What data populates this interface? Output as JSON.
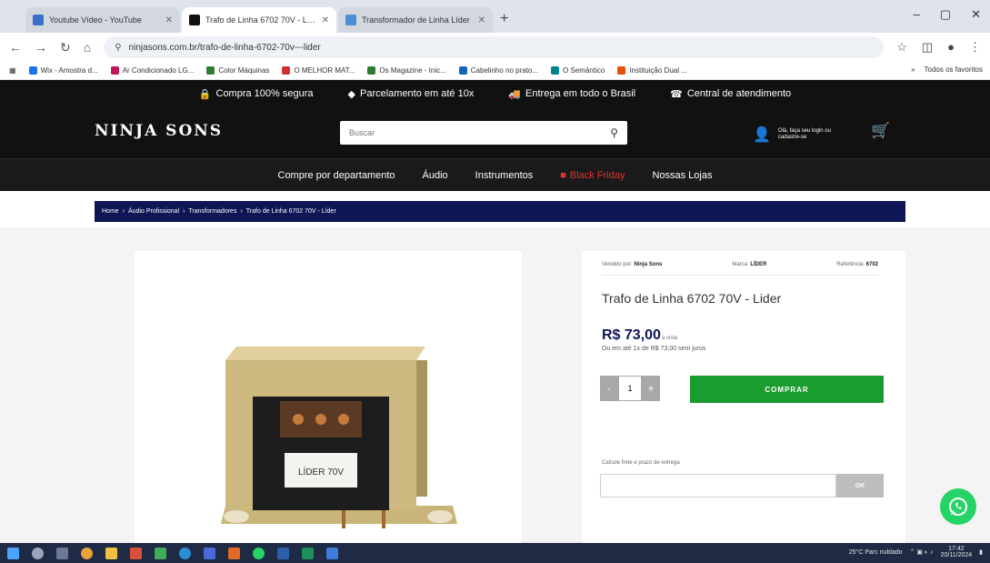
{
  "browser": {
    "tabs": [
      {
        "title": "Youtube Vídeo - YouTube",
        "favicon_color": "#3b6ec9",
        "active": false
      },
      {
        "title": "Trafo de Linha 6702 70V - Líder",
        "favicon_color": "#111111",
        "active": true
      },
      {
        "title": "Transformador de Linha Líder",
        "favicon_color": "#4a90d9",
        "active": false
      }
    ],
    "new_tab": "+",
    "window_controls": [
      "–",
      "▢",
      "✕"
    ],
    "url": "ninjasons.com.br/trafo-de-linha-6702-70v---lider",
    "bookmarks": [
      {
        "label": "Wix - Amostra d...",
        "color": "#1a73e8"
      },
      {
        "label": "Ar Condicionado LG...",
        "color": "#c2185b"
      },
      {
        "label": "Color Máquinas",
        "color": "#2e7d32"
      },
      {
        "label": "O MELHOR MAT...",
        "color": "#d32f2f"
      },
      {
        "label": "Os Magazine - Inic...",
        "color": "#2e7d32"
      },
      {
        "label": "Cabelinho no prato...",
        "color": "#1565c0"
      },
      {
        "label": "O Semântico",
        "color": "#00838f"
      },
      {
        "label": "Instituição Dual ...",
        "color": "#e65100"
      }
    ],
    "bookmarks_more": "»",
    "all_bookmarks": "Todos os favoritos"
  },
  "site": {
    "trust": [
      {
        "icon": "lock-icon",
        "glyph": "🔒",
        "label": "Compra 100% segura"
      },
      {
        "icon": "tag-icon",
        "glyph": "◆",
        "label": "Parcelamento em até 10x"
      },
      {
        "icon": "truck-icon",
        "glyph": "🚚",
        "label": "Entrega em todo o Brasil"
      },
      {
        "icon": "support-icon",
        "glyph": "☎",
        "label": "Central de atendimento"
      }
    ],
    "logo": "NINJA SONS",
    "search_placeholder": "Buscar",
    "account_text": "Olá, faça seu login ou cadastre-se",
    "nav": [
      "Compre por departamento",
      "Áudio",
      "Instrumentos",
      "Black Friday",
      "Nossas Lojas"
    ],
    "breadcrumb": [
      "Home",
      "Áudio Profissional",
      "Transformadores",
      "Trafo de Linha 6702 70V - Líder"
    ],
    "product": {
      "seller_label": "Vendido por:",
      "seller": "Ninja Sons",
      "brand_label": "Marca:",
      "brand": "LÍDER",
      "ref_label": "Referência:",
      "ref": "6702",
      "title": "Trafo de Linha 6702 70V - Lider",
      "price": "R$ 73,00",
      "price_note": "à vista",
      "installments": "Ou em até 1x de R$ 73,00 sem juros",
      "qty": "1",
      "qty_minus": "-",
      "qty_plus": "+",
      "buy_label": "COMPRAR",
      "cep_label": "Calcule frete e prazo de entrega",
      "cep_button": "OK",
      "label_on_part": "LÍDER 70V"
    },
    "accent": "#0e1655",
    "buy_color": "#1a9c2e"
  },
  "taskbar": {
    "weather": "25°C Parc nublado",
    "time": "17:42",
    "date": "20/11/2024"
  }
}
